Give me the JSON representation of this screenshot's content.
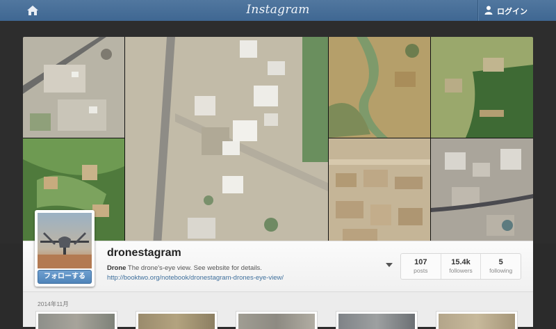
{
  "nav": {
    "brand": "Instagram",
    "login_label": "ログイン",
    "home_icon": "home-icon",
    "user_icon": "user-icon"
  },
  "profile": {
    "username": "dronestagram",
    "full_name": "Drone",
    "bio": "The drone's-eye view. See website for details.",
    "website": "http://booktwo.org/notebook/dronestagram-drones-eye-view/",
    "follow_label": "フォローする",
    "stats": [
      {
        "value": "107",
        "label": "posts"
      },
      {
        "value": "15.4k",
        "label": "followers"
      },
      {
        "value": "5",
        "label": "following"
      }
    ]
  },
  "feed": {
    "month_label": "2014年11月"
  },
  "colors": {
    "nav": "#4a6f98",
    "follow_button": "#5a8cc0",
    "link": "#3e6f9c"
  }
}
